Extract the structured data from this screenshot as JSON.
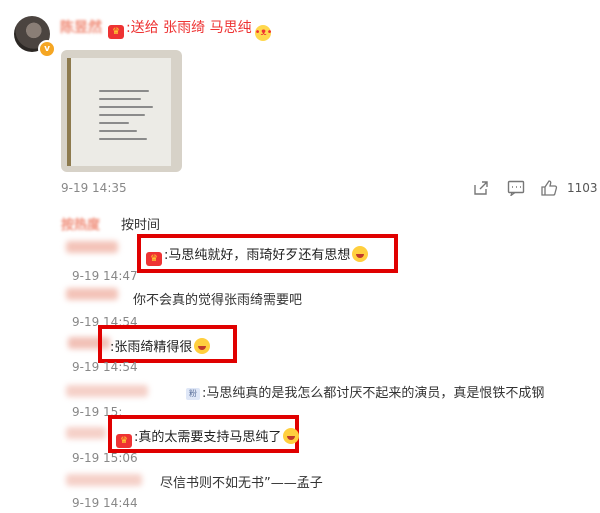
{
  "post": {
    "username": "陈昱然",
    "text_prefix": ":送给",
    "mentions": "张雨绮 马思纯",
    "time": "9-19 14:35",
    "like_count": "1103"
  },
  "sort": {
    "hot_label": "按热度",
    "time_label": "按时间"
  },
  "comments": [
    {
      "text": ":马思纯就好，雨琦好歹还有思想",
      "time": "9-19 14:47"
    },
    {
      "text": "你不会真的觉得张雨绮需要吧",
      "time": "9-19 14:54"
    },
    {
      "text": ":张雨绮精得很",
      "time": "9-19 14:54"
    },
    {
      "text": ":马思纯真的是我怎么都讨厌不起来的演员，真是恨铁不成钢",
      "time": "9-19 15:"
    },
    {
      "text": ":真的太需要支持马思纯了",
      "time": "9-19 15:06"
    },
    {
      "text": "尽信书则不如无书”——孟子",
      "time": "9-19 14:44"
    }
  ],
  "tag_label": "粉",
  "icons": [
    "share-icon",
    "comment-icon",
    "like-icon",
    "crown-badge-icon",
    "laugh-emoji-icon"
  ],
  "colors": {
    "highlight_box": "#e00000",
    "mention": "#e33333",
    "muted": "#888888"
  }
}
